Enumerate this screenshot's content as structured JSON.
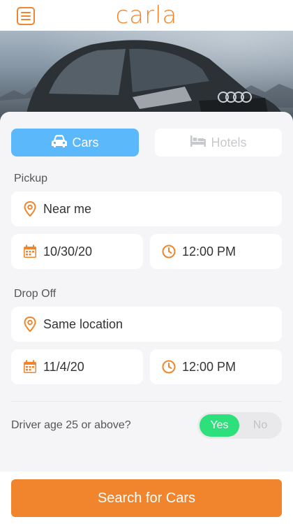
{
  "header": {
    "logo": "carla",
    "menu_icon": "hamburger-menu-icon"
  },
  "tabs": [
    {
      "label": "Cars",
      "icon": "car-icon",
      "selected": true
    },
    {
      "label": "Hotels",
      "icon": "bed-icon",
      "selected": false
    }
  ],
  "pickup": {
    "section_label": "Pickup",
    "location": "Near me",
    "date": "10/30/20",
    "time": "12:00 PM"
  },
  "dropoff": {
    "section_label": "Drop Off",
    "location": "Same location",
    "date": "11/4/20",
    "time": "12:00 PM"
  },
  "driver_age": {
    "label": "Driver age 25 or above?",
    "yes_label": "Yes",
    "no_label": "No",
    "selected": "Yes"
  },
  "search_button": "Search for Cars",
  "colors": {
    "accent": "#f0852d",
    "tab_active": "#5ab8fb",
    "toggle_on": "#2ee07b"
  }
}
